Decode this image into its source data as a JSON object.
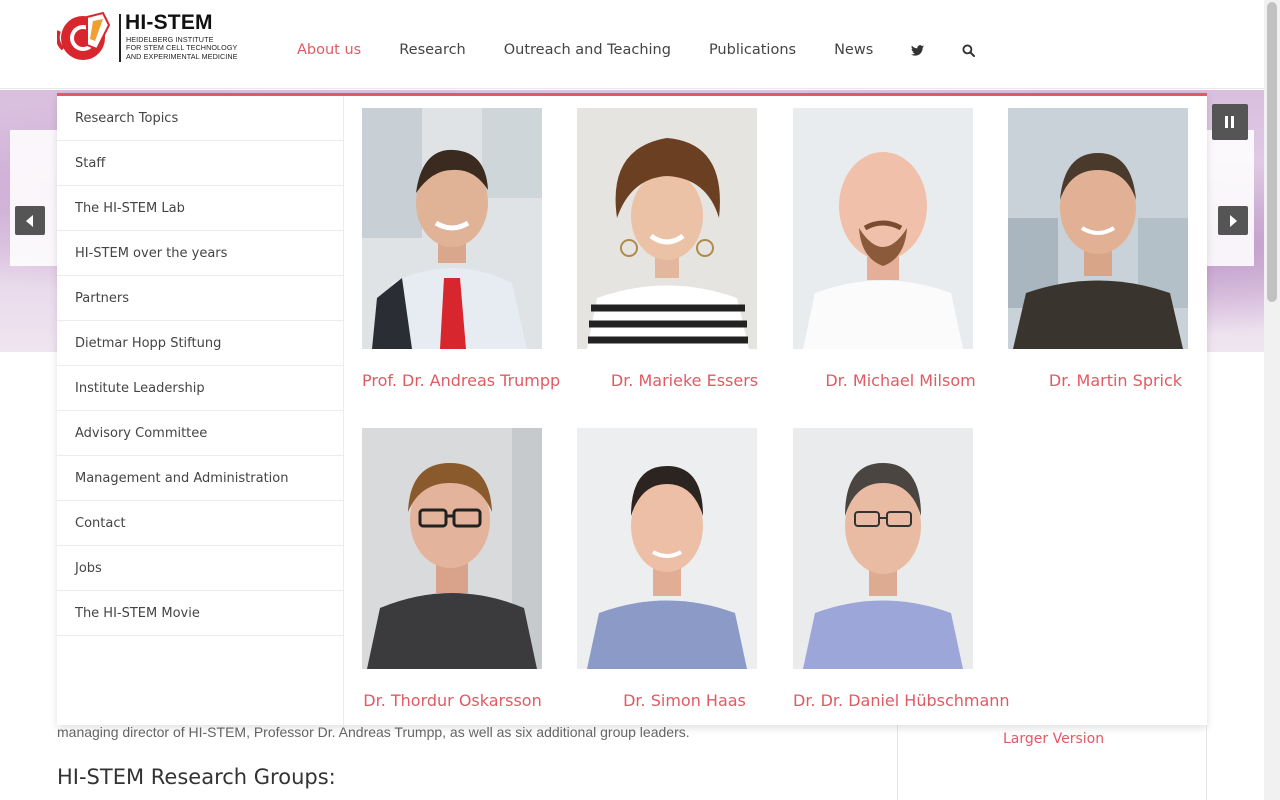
{
  "header": {
    "logo": {
      "title": "HI-STEM",
      "subtitle_line1": "HEIDELBERG INSTITUTE",
      "subtitle_line2": "FOR STEM CELL TECHNOLOGY",
      "subtitle_line3": "AND EXPERIMENTAL MEDICINE"
    },
    "nav": {
      "about": "About us",
      "research": "Research",
      "outreach": "Outreach and Teaching",
      "publications": "Publications",
      "news": "News",
      "twitter_icon": "twitter-icon",
      "search_icon": "search-icon"
    }
  },
  "mega_menu": {
    "submenu": [
      "Research Topics",
      "Staff",
      "The HI-STEM Lab",
      "HI-STEM over the years",
      "Partners",
      "Dietmar Hopp Stiftung",
      "Institute Leadership",
      "Advisory Committee",
      "Management and Administration",
      "Contact",
      "Jobs",
      "The HI-STEM Movie"
    ],
    "people": [
      "Prof. Dr. Andreas Trumpp",
      "Dr. Marieke Essers",
      "Dr. Michael Milsom",
      "Dr. Martin Sprick",
      "Dr. Thordur Oskarsson",
      "Dr. Simon Haas",
      "Dr. Dr. Daniel Hübschmann"
    ]
  },
  "page": {
    "body_text": "managing director of HI-STEM, Professor Dr. Andreas Trumpp, as well as six additional group leaders.",
    "groups_heading": "HI-STEM Research Groups:",
    "larger_version": "Larger Version"
  },
  "colors": {
    "accent": "#e05a64",
    "nav_text": "#444444"
  }
}
